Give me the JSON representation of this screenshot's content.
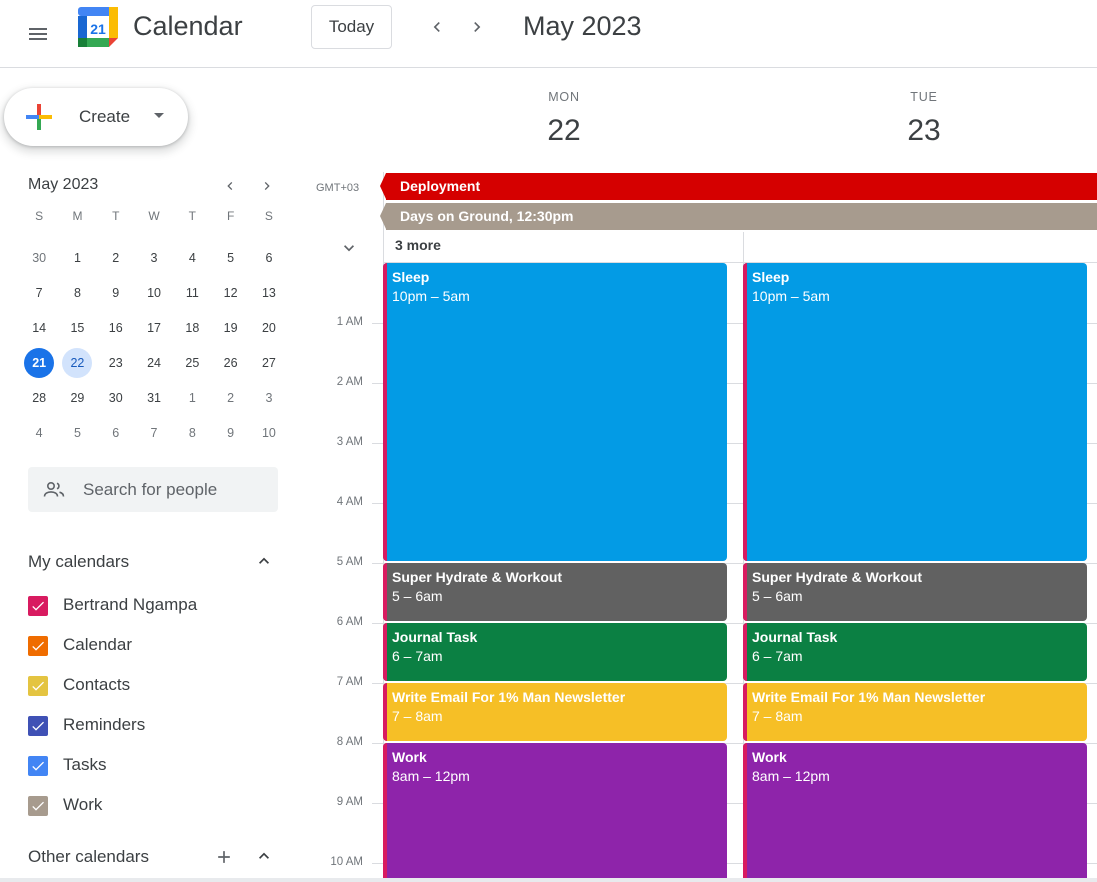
{
  "header": {
    "app_title": "Calendar",
    "logo_day": "21",
    "today_label": "Today",
    "month_title": "May 2023"
  },
  "create": {
    "label": "Create"
  },
  "mini_calendar": {
    "title": "May 2023",
    "dows": [
      "S",
      "M",
      "T",
      "W",
      "T",
      "F",
      "S"
    ],
    "weeks": [
      [
        "30",
        "1",
        "2",
        "3",
        "4",
        "5",
        "6"
      ],
      [
        "7",
        "8",
        "9",
        "10",
        "11",
        "12",
        "13"
      ],
      [
        "14",
        "15",
        "16",
        "17",
        "18",
        "19",
        "20"
      ],
      [
        "21",
        "22",
        "23",
        "24",
        "25",
        "26",
        "27"
      ],
      [
        "28",
        "29",
        "30",
        "31",
        "1",
        "2",
        "3"
      ],
      [
        "4",
        "5",
        "6",
        "7",
        "8",
        "9",
        "10"
      ]
    ],
    "today": "21",
    "selected": "22"
  },
  "search_people": {
    "placeholder": "Search for people"
  },
  "my_calendars": {
    "title": "My calendars",
    "items": [
      {
        "name": "Bertrand Ngampa",
        "color": "#d81b60"
      },
      {
        "name": "Calendar",
        "color": "#ef6c00"
      },
      {
        "name": "Contacts",
        "color": "#e4c441"
      },
      {
        "name": "Reminders",
        "color": "#3f51b5"
      },
      {
        "name": "Tasks",
        "color": "#4285f4"
      },
      {
        "name": "Work",
        "color": "#a79b8e"
      }
    ]
  },
  "other_calendars": {
    "title": "Other calendars"
  },
  "week": {
    "timezone": "GMT+03",
    "days": [
      {
        "dow": "MON",
        "num": "22"
      },
      {
        "dow": "TUE",
        "num": "23"
      }
    ],
    "all_day": [
      {
        "title": "Deployment",
        "color": "#d50000"
      },
      {
        "title": "Days on Ground, 12:30pm",
        "color": "#a79b8e"
      }
    ],
    "more_label": "3 more",
    "hours": [
      "1 AM",
      "2 AM",
      "3 AM",
      "4 AM",
      "5 AM",
      "6 AM",
      "7 AM",
      "8 AM",
      "9 AM",
      "10 AM"
    ],
    "events": [
      {
        "title": "Sleep",
        "time": "10pm – 5am",
        "color": "#039be5"
      },
      {
        "title": "Super Hydrate & Workout",
        "time": "5 – 6am",
        "color": "#616161"
      },
      {
        "title": "Journal Task",
        "time": "6 – 7am",
        "color": "#0b8043"
      },
      {
        "title": "Write Email For 1% Man Newsletter",
        "time": "7 – 8am",
        "color": "#f6bf26"
      },
      {
        "title": "Work",
        "time": "8am – 12pm",
        "color": "#8e24aa"
      }
    ],
    "event_strip_color": "#d81b60"
  }
}
